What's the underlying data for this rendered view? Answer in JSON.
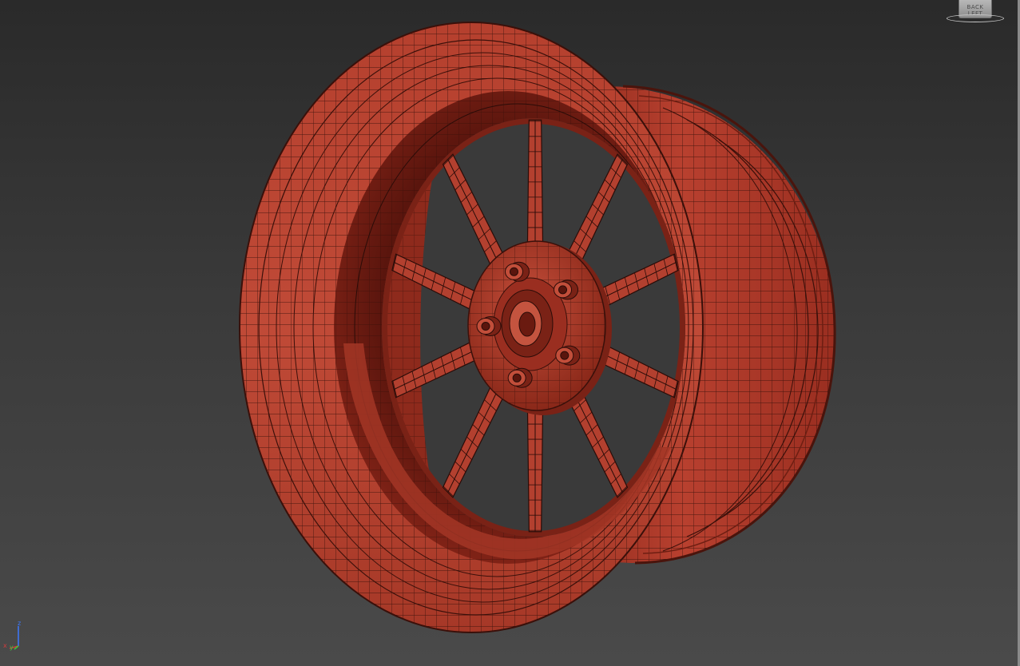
{
  "viewport": {
    "background_top": "#2a2a2a",
    "background_bottom": "#4a4a4a"
  },
  "model": {
    "icon": "wheel-rim-wireframe",
    "color": "#b3402f",
    "wire_color": "#2a0c08",
    "spoke_count": 10,
    "lug_nut_count": 5
  },
  "viewcube": {
    "label": "BACK  LEFT"
  },
  "axis_gizmo": {
    "x_label": "x",
    "y_label": "y",
    "z_label": "z",
    "x_color": "#d23c3c",
    "y_color": "#3cc83c",
    "z_color": "#3c78ff"
  }
}
